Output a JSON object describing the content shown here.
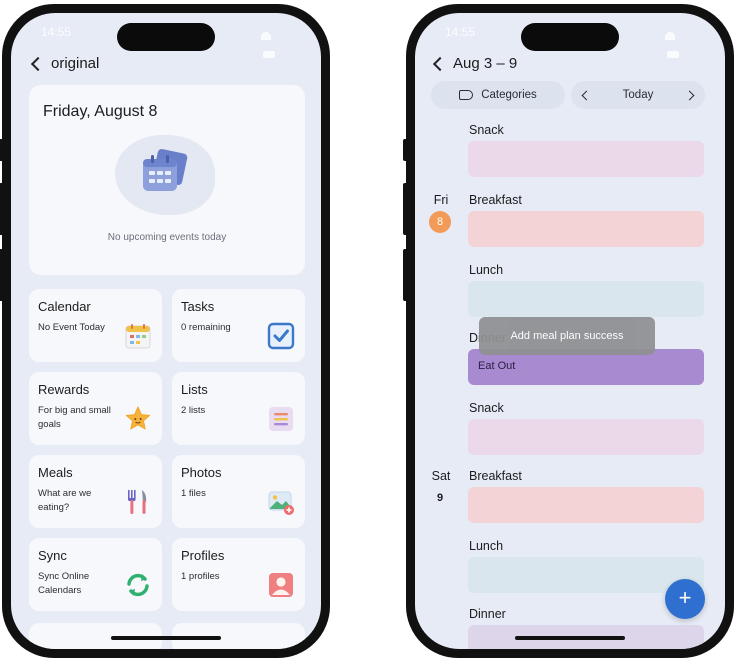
{
  "status_time": "14:55",
  "left_screen": {
    "back_label": "original",
    "date_title": "Friday, August 8",
    "empty_text": "No upcoming events today",
    "tiles": [
      {
        "title": "Calendar",
        "subtitle": "No Event Today",
        "icon": "calendar-icon"
      },
      {
        "title": "Tasks",
        "subtitle": "0 remaining",
        "icon": "checkbox-icon"
      },
      {
        "title": "Rewards",
        "subtitle": "For big and small goals",
        "icon": "star-icon"
      },
      {
        "title": "Lists",
        "subtitle": "2 lists",
        "icon": "list-icon"
      },
      {
        "title": "Meals",
        "subtitle": "What are we eating?",
        "icon": "utensils-icon"
      },
      {
        "title": "Photos",
        "subtitle": "1 files",
        "icon": "photo-icon"
      },
      {
        "title": "Sync",
        "subtitle": "Sync Online Calendars",
        "icon": "sync-icon"
      },
      {
        "title": "Profiles",
        "subtitle": "1 profiles",
        "icon": "profile-icon"
      }
    ]
  },
  "right_screen": {
    "back_label": "Aug 3 – 9",
    "categories_label": "Categories",
    "today_label": "Today",
    "toast": "Add meal plan success",
    "fab_label": "+",
    "days": [
      {
        "name": "Fri",
        "number": "8",
        "is_today": true
      },
      {
        "name": "Sat",
        "number": "9",
        "is_today": false
      }
    ],
    "meals": [
      {
        "label": "Snack",
        "entry": ""
      },
      {
        "label": "Breakfast",
        "entry": ""
      },
      {
        "label": "Lunch",
        "entry": ""
      },
      {
        "label": "Dinner",
        "entry": "Eat Out"
      },
      {
        "label": "Snack",
        "entry": ""
      },
      {
        "label": "Breakfast",
        "entry": ""
      },
      {
        "label": "Lunch",
        "entry": ""
      },
      {
        "label": "Dinner",
        "entry": ""
      }
    ]
  },
  "colors": {
    "accent_blue": "#2f6fcf",
    "today_badge": "#f29a57",
    "dinner_entry": "#a78ad0",
    "screen_bg": "#e6ebf5"
  }
}
